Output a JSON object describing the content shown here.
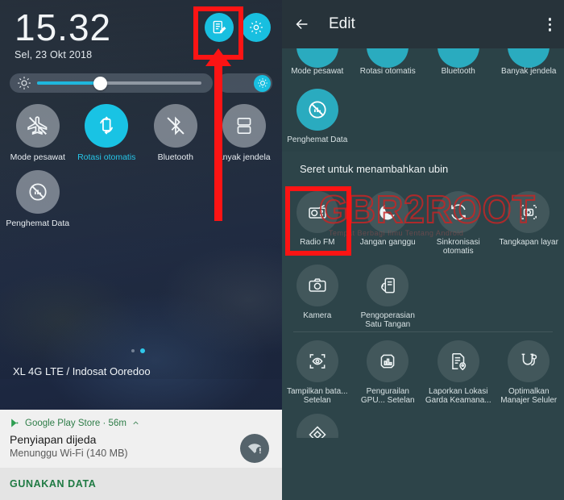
{
  "left_panel": {
    "status": {
      "time": "15.32",
      "date": "Sel, 23 Okt 2018"
    },
    "header_icons": [
      {
        "name": "edit-icon",
        "label": "Edit"
      },
      {
        "name": "settings-gear-icon",
        "label": "Setelan"
      }
    ],
    "brightness": {
      "icon": "brightness-icon",
      "auto_icon": "auto-brightness-icon",
      "value_percent": 37
    },
    "tiles": [
      {
        "label": "Mode pesawat",
        "icon": "airplane-off-icon",
        "active": false
      },
      {
        "label": "Rotasi otomatis",
        "icon": "auto-rotate-icon",
        "active": true
      },
      {
        "label": "Bluetooth",
        "icon": "bluetooth-off-icon",
        "active": false
      },
      {
        "label": "anyak jendela",
        "icon": "multi-window-icon",
        "active": false
      },
      {
        "label": "Penghemat Data",
        "icon": "data-saver-off-icon",
        "active": false
      }
    ],
    "carrier": "XL 4G LTE / Indosat Ooredoo",
    "notification": {
      "app": "Google Play Store · 56m",
      "app_icon": "google-play-icon",
      "collapse_icon": "chevron-up-icon",
      "title": "Penyiapan dijeda",
      "subtitle": "Menunggu Wi-Fi (140 MB)",
      "status_icon": "wifi-alert-icon",
      "action": "GUNAKAN DATA"
    },
    "annotation_color": "#fc1414"
  },
  "right_panel": {
    "header": {
      "back_icon": "arrow-left-icon",
      "title": "Edit",
      "more_icon": "overflow-menu-icon"
    },
    "active_tiles_cut": [
      {
        "label": "Mode pesawat",
        "icon": "airplane-off-icon",
        "active": true
      },
      {
        "label": "Rotasi otomatis",
        "icon": "auto-rotate-icon",
        "active": true
      },
      {
        "label": "Bluetooth",
        "icon": "bluetooth-off-icon",
        "active": true
      },
      {
        "label": "Banyak jendela",
        "icon": "multi-window-icon",
        "active": true
      }
    ],
    "active_tiles": [
      {
        "label": "Penghemat Data",
        "icon": "data-saver-off-icon",
        "active": true
      }
    ],
    "drag_hint": "Seret untuk menambahkan ubin",
    "watermark": {
      "text": "GBR2ROOT",
      "subtext": "Tempat Berbagi Ilmu Tentang Android",
      "color": "#c42626"
    },
    "available_tiles": [
      {
        "label": "Radio FM",
        "icon": "radio-icon",
        "highlighted": true
      },
      {
        "label": "Jangan ganggu",
        "icon": "do-not-disturb-moon-icon",
        "highlighted": false
      },
      {
        "label": "Sinkronisasi otomatis",
        "icon": "sync-icon",
        "highlighted": false
      },
      {
        "label": "Tangkapan layar",
        "icon": "screenshot-icon",
        "highlighted": false
      },
      {
        "label": "Kamera",
        "icon": "camera-icon",
        "highlighted": false
      },
      {
        "label": "Pengoperasian Satu Tangan",
        "icon": "one-hand-operation-icon",
        "highlighted": false
      }
    ],
    "developer_tiles": [
      {
        "label": "Tampilkan bata... Setelan",
        "icon": "show-layout-bounds-icon"
      },
      {
        "label": "Pengurailan GPU... Setelan",
        "icon": "gpu-rendering-icon"
      },
      {
        "label": "Laporkan Lokasi Garda Keamana...",
        "icon": "location-report-icon"
      },
      {
        "label": "Optimalkan Manajer Seluler",
        "icon": "mobile-manager-icon"
      }
    ],
    "bottom_partial_tile": {
      "label": "",
      "icon": "diamond-icon"
    },
    "annotation_color": "#fc1414"
  }
}
